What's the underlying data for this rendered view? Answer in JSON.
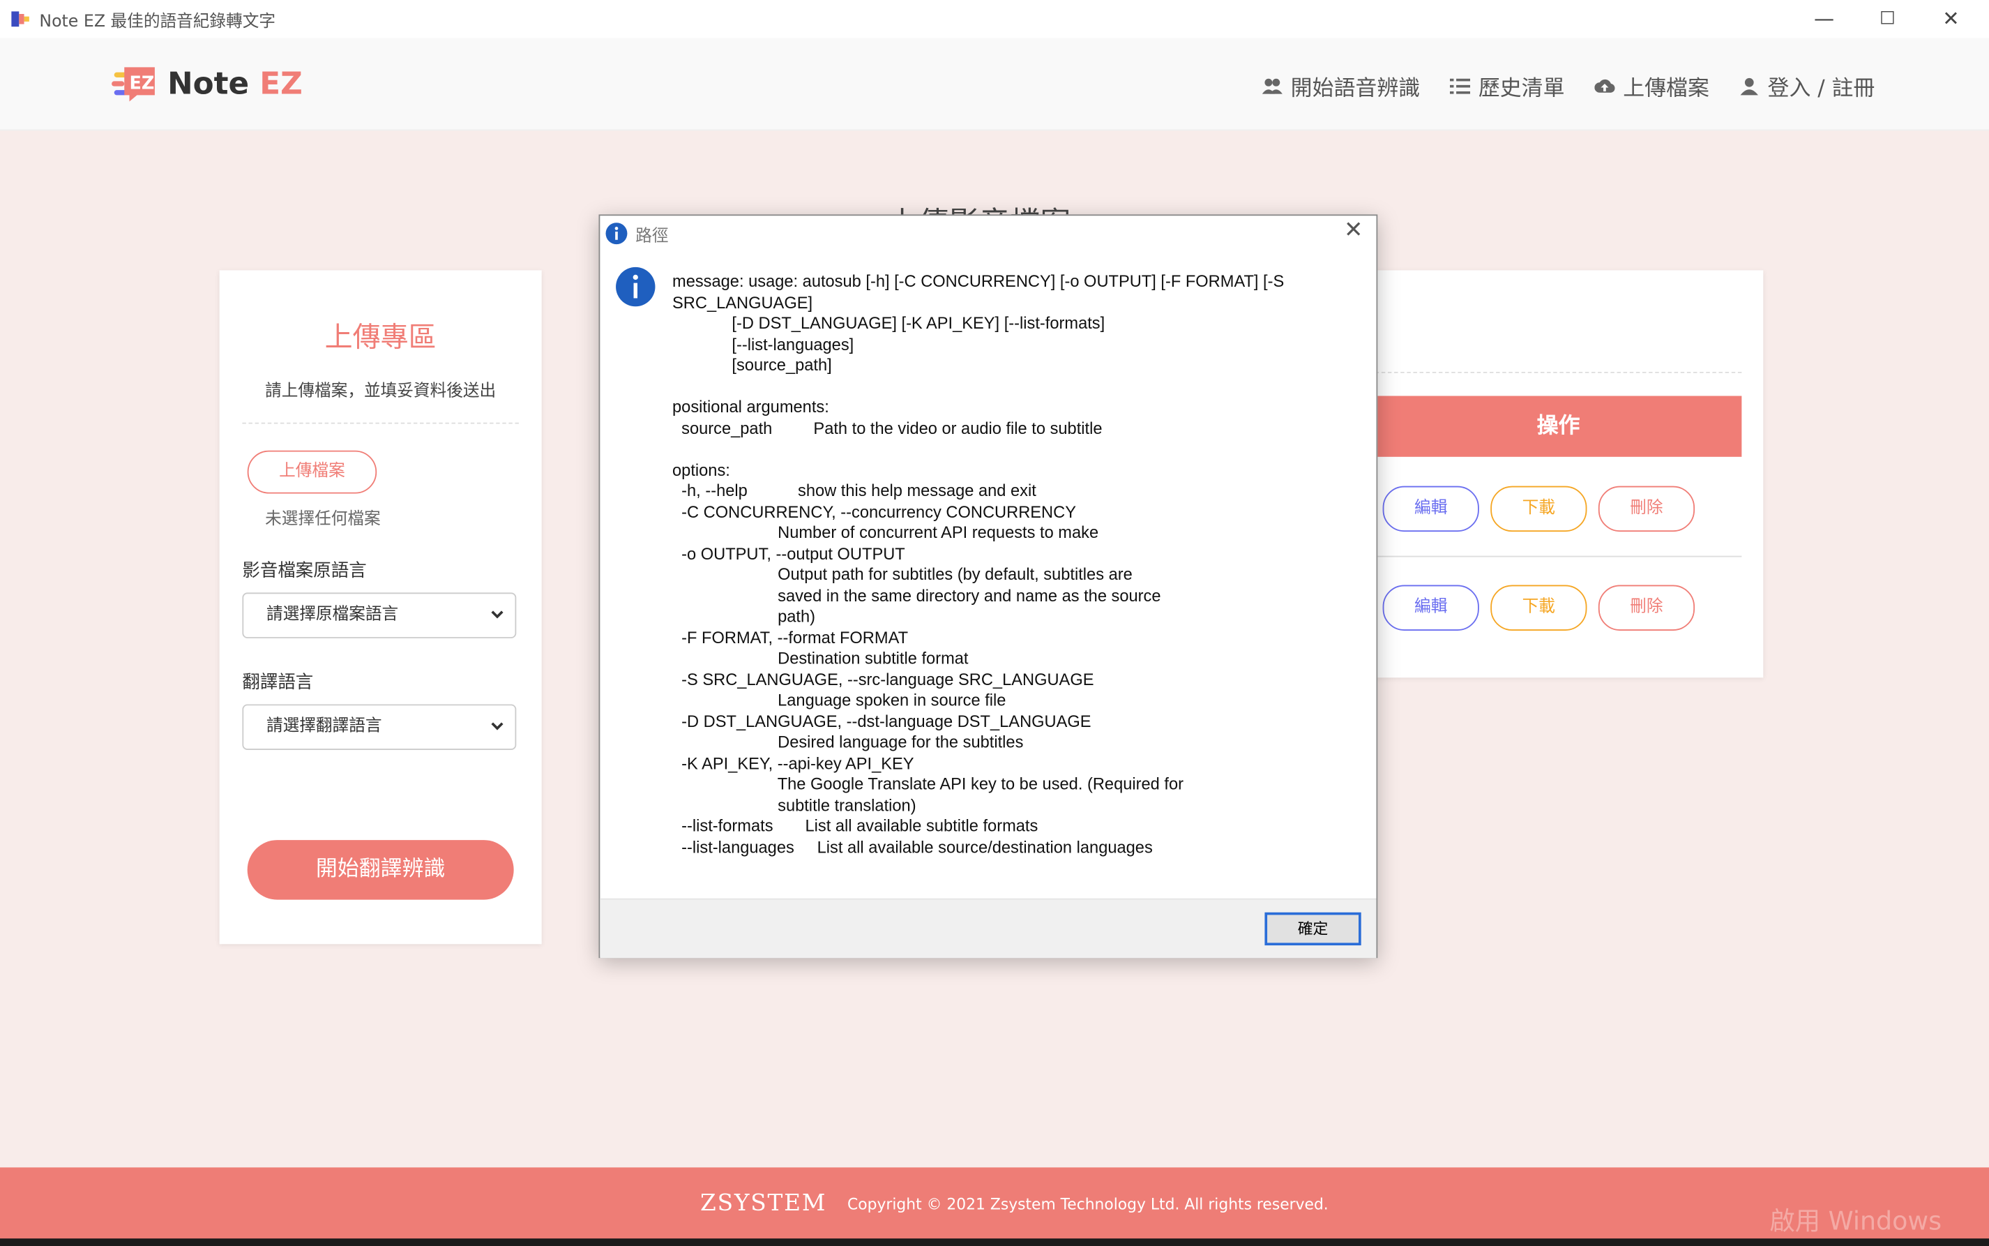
{
  "window": {
    "title": "Note EZ 最佳的語音紀錄轉文字",
    "minimize": "—",
    "maximize": "☐",
    "close": "✕"
  },
  "navbar": {
    "logo_text_main": "Note ",
    "logo_text_accent": "EZ",
    "items": [
      {
        "label": "開始語音辨識",
        "icon": "users-icon"
      },
      {
        "label": "歷史清單",
        "icon": "list-icon"
      },
      {
        "label": "上傳檔案",
        "icon": "cloud-upload-icon"
      },
      {
        "label": "登入 / 註冊",
        "icon": "user-icon"
      }
    ]
  },
  "page": {
    "heading": "上傳影音檔案"
  },
  "upload_card": {
    "title": "上傳專區",
    "subtitle": "請上傳檔案，並填妥資料後送出",
    "upload_button": "上傳檔案",
    "no_file_text": "未選擇任何檔案",
    "source_lang_label": "影音檔案原語言",
    "source_lang_select": "請選擇原檔案語言",
    "target_lang_label": "翻譯語言",
    "target_lang_select": "請選擇翻譯語言",
    "start_button": "開始翻譯辨識"
  },
  "right_card": {
    "operation_header": "操作",
    "rows": [
      {
        "edit": "編輯",
        "download": "下載",
        "delete": "刪除"
      },
      {
        "edit": "編輯",
        "download": "下載",
        "delete": "刪除"
      }
    ]
  },
  "dialog": {
    "title": "路徑",
    "close": "✕",
    "message": "message: usage: autosub [-h] [-C CONCURRENCY] [-o OUTPUT] [-F FORMAT] [-S\nSRC_LANGUAGE]\n             [-D DST_LANGUAGE] [-K API_KEY] [--list-formats]\n             [--list-languages]\n             [source_path]\n\npositional arguments:\n  source_path         Path to the video or audio file to subtitle\n\noptions:\n  -h, --help           show this help message and exit\n  -C CONCURRENCY, --concurrency CONCURRENCY\n                       Number of concurrent API requests to make\n  -o OUTPUT, --output OUTPUT\n                       Output path for subtitles (by default, subtitles are\n                       saved in the same directory and name as the source\n                       path)\n  -F FORMAT, --format FORMAT\n                       Destination subtitle format\n  -S SRC_LANGUAGE, --src-language SRC_LANGUAGE\n                       Language spoken in source file\n  -D DST_LANGUAGE, --dst-language DST_LANGUAGE\n                       Desired language for the subtitles\n  -K API_KEY, --api-key API_KEY\n                       The Google Translate API key to be used. (Required for\n                       subtitle translation)\n  --list-formats       List all available subtitle formats\n  --list-languages     List all available source/destination languages",
    "ok_button": "確定"
  },
  "footer": {
    "brand": "ZSYSTEM",
    "copyright": "Copyright © 2021 Zsystem Technology Ltd. All rights reserved."
  },
  "watermark": "啟用 Windows",
  "colors": {
    "accent": "#f07d76",
    "edit": "#6a6ef0",
    "download": "#f5a623",
    "background": "#f8ecea"
  }
}
